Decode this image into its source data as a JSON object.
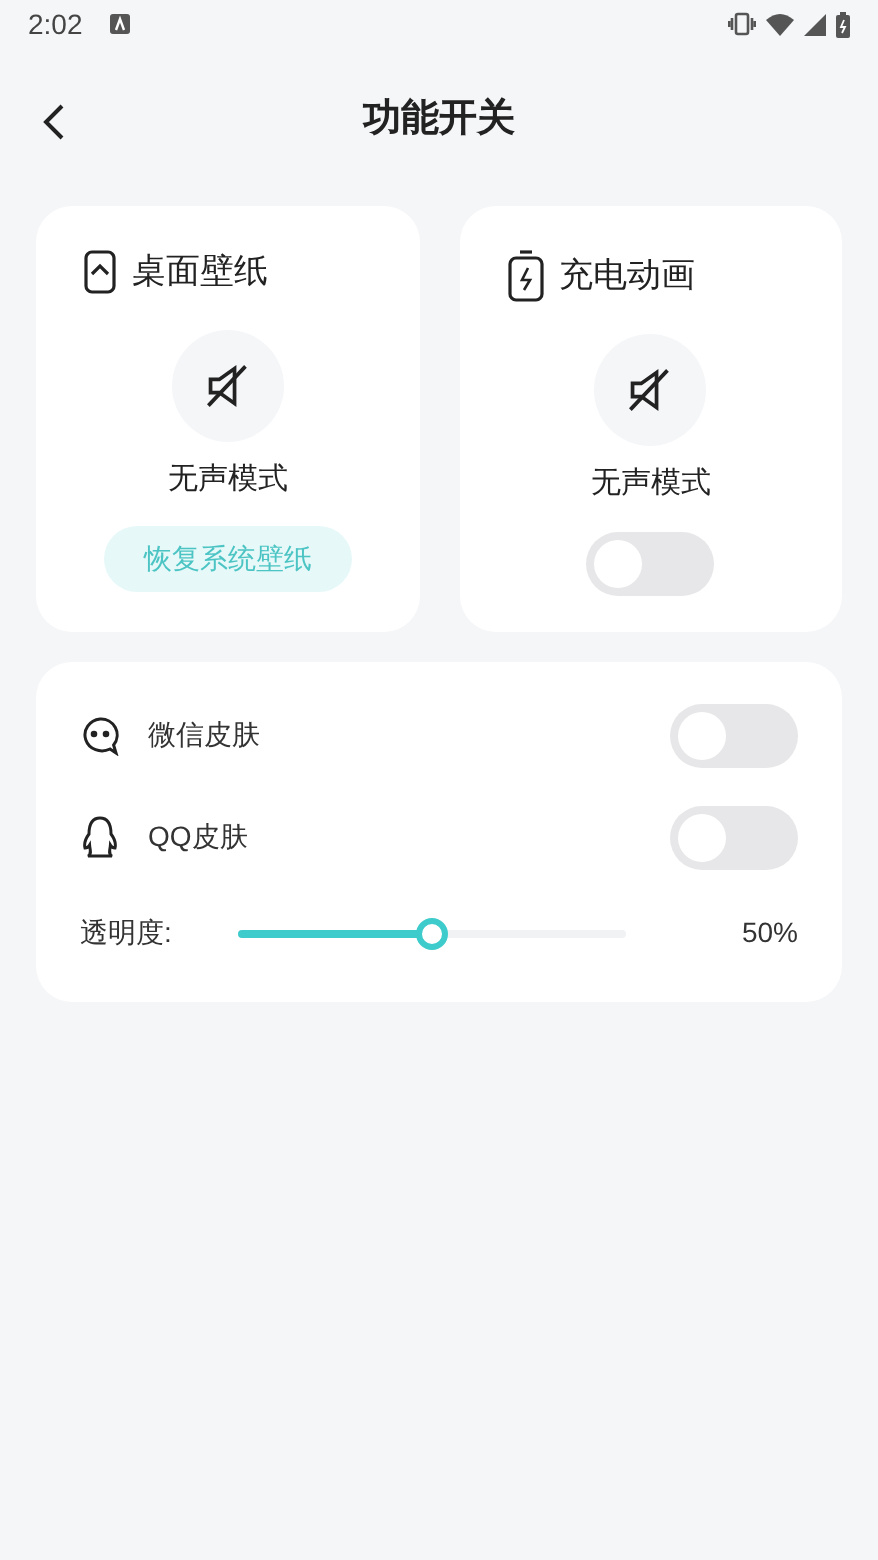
{
  "status_bar": {
    "time": "2:02"
  },
  "header": {
    "title": "功能开关"
  },
  "feature_cards": [
    {
      "title": "桌面壁纸",
      "mode_label": "无声模式",
      "kind": "button",
      "action_label": "恢复系统壁纸"
    },
    {
      "title": "充电动画",
      "mode_label": "无声模式",
      "kind": "toggle",
      "on": false
    }
  ],
  "skins": [
    {
      "label": "微信皮肤",
      "on": false
    },
    {
      "label": "QQ皮肤",
      "on": false
    }
  ],
  "opacity": {
    "label": "透明度:",
    "level": 0.5,
    "reading": "50%"
  }
}
